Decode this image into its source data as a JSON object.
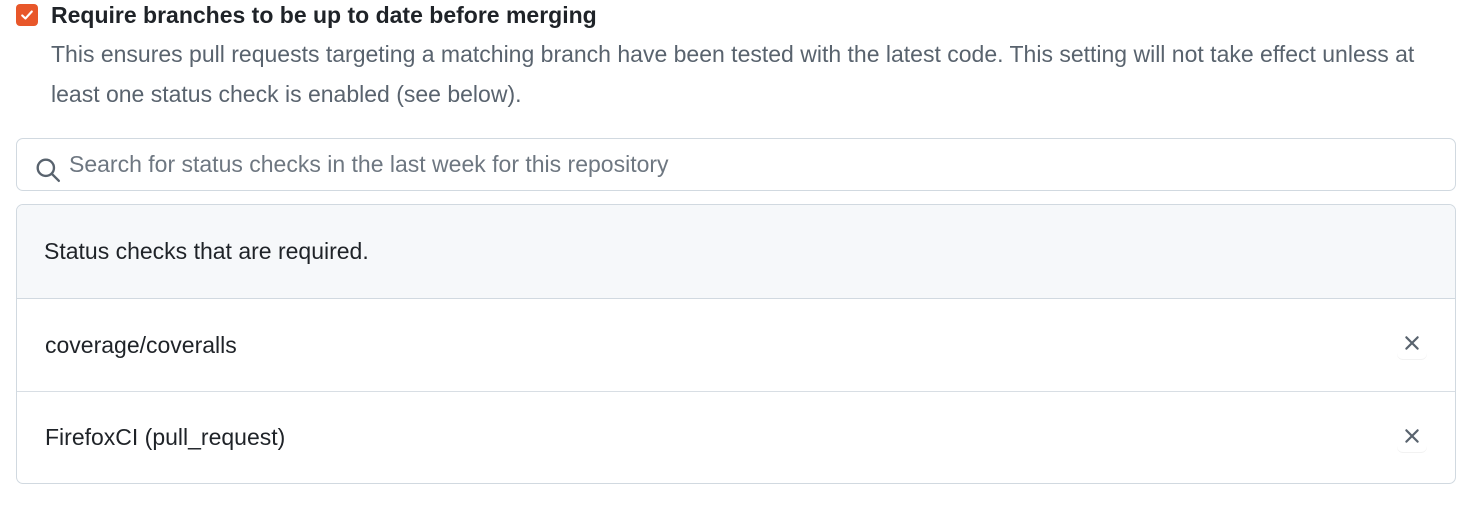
{
  "require_up_to_date": {
    "checked": true,
    "title": "Require branches to be up to date before merging",
    "description": "This ensures pull requests targeting a matching branch have been tested with the latest code. This setting will not take effect unless at least one status check is enabled (see below)."
  },
  "search": {
    "placeholder": "Search for status checks in the last week for this repository",
    "icon": "search-icon"
  },
  "required_checks": {
    "header": "Status checks that are required.",
    "items": [
      {
        "name": "coverage/coveralls",
        "remove_icon": "close-icon"
      },
      {
        "name": "FirefoxCI (pull_request)",
        "remove_icon": "close-icon"
      }
    ]
  },
  "colors": {
    "accent": "#e8572a",
    "border": "#d1d9e0",
    "header_bg": "#f6f8fa",
    "muted_text": "#59636e"
  }
}
